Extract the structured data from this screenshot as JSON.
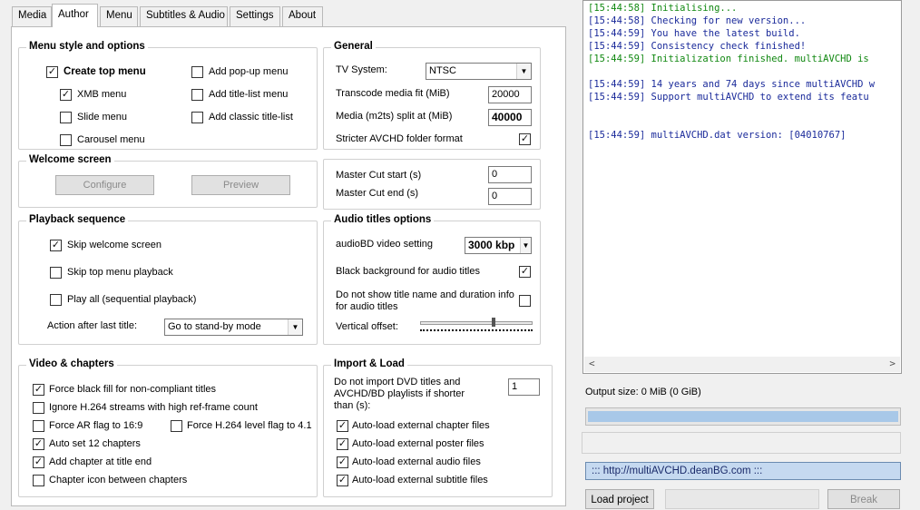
{
  "tabs": [
    "Media",
    "Author",
    "Menu",
    "Subtitles & Audio",
    "Settings",
    "About"
  ],
  "active_tab": "Author",
  "menu_style": {
    "title": "Menu style and options",
    "create_top_menu": {
      "label": "Create top menu",
      "checked": true
    },
    "xmb_menu": {
      "label": "XMB menu",
      "checked": true
    },
    "slide_menu": {
      "label": "Slide menu",
      "checked": false
    },
    "carousel_menu": {
      "label": "Carousel menu",
      "checked": false
    },
    "add_popup_menu": {
      "label": "Add pop-up menu",
      "checked": false
    },
    "add_title_list_menu": {
      "label": "Add title-list menu",
      "checked": false
    },
    "add_classic_title_list": {
      "label": "Add classic title-list",
      "checked": false
    }
  },
  "welcome_screen": {
    "title": "Welcome screen",
    "configure_label": "Configure",
    "preview_label": "Preview"
  },
  "playback_sequence": {
    "title": "Playback sequence",
    "skip_welcome": {
      "label": "Skip welcome screen",
      "checked": true
    },
    "skip_top_menu": {
      "label": "Skip top menu playback",
      "checked": false
    },
    "play_all": {
      "label": "Play all (sequential playback)",
      "checked": false
    },
    "action_label": "Action after last title:",
    "action_value": "Go to stand-by mode"
  },
  "general": {
    "title": "General",
    "tv_system_label": "TV System:",
    "tv_system_value": "NTSC",
    "transcode_label": "Transcode media fit (MiB)",
    "transcode_value": "20000",
    "split_label": "Media (m2ts) split at (MiB)",
    "split_value": "40000",
    "stricter_label": "Stricter AVCHD folder format",
    "stricter_checked": true
  },
  "master_cut": {
    "start_label": "Master Cut start (s)",
    "start_value": "0",
    "end_label": "Master Cut end (s)",
    "end_value": "0"
  },
  "audio_titles": {
    "title": "Audio titles options",
    "audiobd_label": "audioBD video setting",
    "audiobd_value": "3000 kbp",
    "black_bg_label": "Black background for audio titles",
    "black_bg_checked": true,
    "no_show_label_1": "Do not show title name and duration info",
    "no_show_label_2": "for audio titles",
    "no_show_checked": false,
    "vertical_offset_label": "Vertical offset:",
    "vertical_offset_fraction": 0.66
  },
  "video_chapters": {
    "title": "Video & chapters",
    "force_black": {
      "label": "Force black fill for non-compliant titles",
      "checked": true
    },
    "ignore_h264": {
      "label": "Ignore H.264 streams with high ref-frame count",
      "checked": false
    },
    "force_ar": {
      "label": "Force AR flag to 16:9",
      "checked": false
    },
    "force_h264_level": {
      "label": "Force H.264 level flag to 4.1",
      "checked": false
    },
    "auto_set_12": {
      "label": "Auto set 12 chapters",
      "checked": true
    },
    "add_chapter_end": {
      "label": "Add chapter at title end",
      "checked": true
    },
    "chapter_icon": {
      "label": "Chapter icon between chapters",
      "checked": false
    }
  },
  "import_load": {
    "title": "Import & Load",
    "no_import_1": "Do not import DVD titles and",
    "no_import_2": "AVCHD/BD playlists if shorter",
    "no_import_3": "than (s):",
    "no_import_value": "1",
    "auto_chapter": {
      "label": "Auto-load external chapter files",
      "checked": true
    },
    "auto_poster": {
      "label": "Auto-load external poster files",
      "checked": true
    },
    "auto_audio": {
      "label": "Auto-load external audio files",
      "checked": true
    },
    "auto_subtitle": {
      "label": "Auto-load external subtitle files",
      "checked": true
    }
  },
  "log": [
    {
      "text": "[15:44:58] Initialising...",
      "color": "green"
    },
    {
      "text": "[15:44:58] Checking for new version...",
      "color": "blue"
    },
    {
      "text": "[15:44:59] You have the latest build.",
      "color": "blue"
    },
    {
      "text": "[15:44:59] Consistency check finished!",
      "color": "blue"
    },
    {
      "text": "[15:44:59] Initialization finished. multiAVCHD is",
      "color": "green"
    },
    {
      "text": "",
      "color": "blue"
    },
    {
      "text": "[15:44:59] 14 years and 74 days since multiAVCHD w",
      "color": "blue"
    },
    {
      "text": "[15:44:59] Support multiAVCHD to extend its featu",
      "color": "blue"
    },
    {
      "text": "",
      "color": "blue"
    },
    {
      "text": "",
      "color": "blue"
    },
    {
      "text": "[15:44:59] multiAVCHD.dat version: [04010767]",
      "color": "blue"
    }
  ],
  "output_size": "Output size: 0 MiB (0 GiB)",
  "progress_fraction": 1.0,
  "url_text": "::: http://multiAVCHD.deanBG.com :::",
  "load_project_label": "Load project",
  "break_label": "Break",
  "check_mark": "✓",
  "colors": {
    "accent": "#a8c8e8",
    "log_green": "#118811",
    "log_blue": "#1a2a9a"
  }
}
